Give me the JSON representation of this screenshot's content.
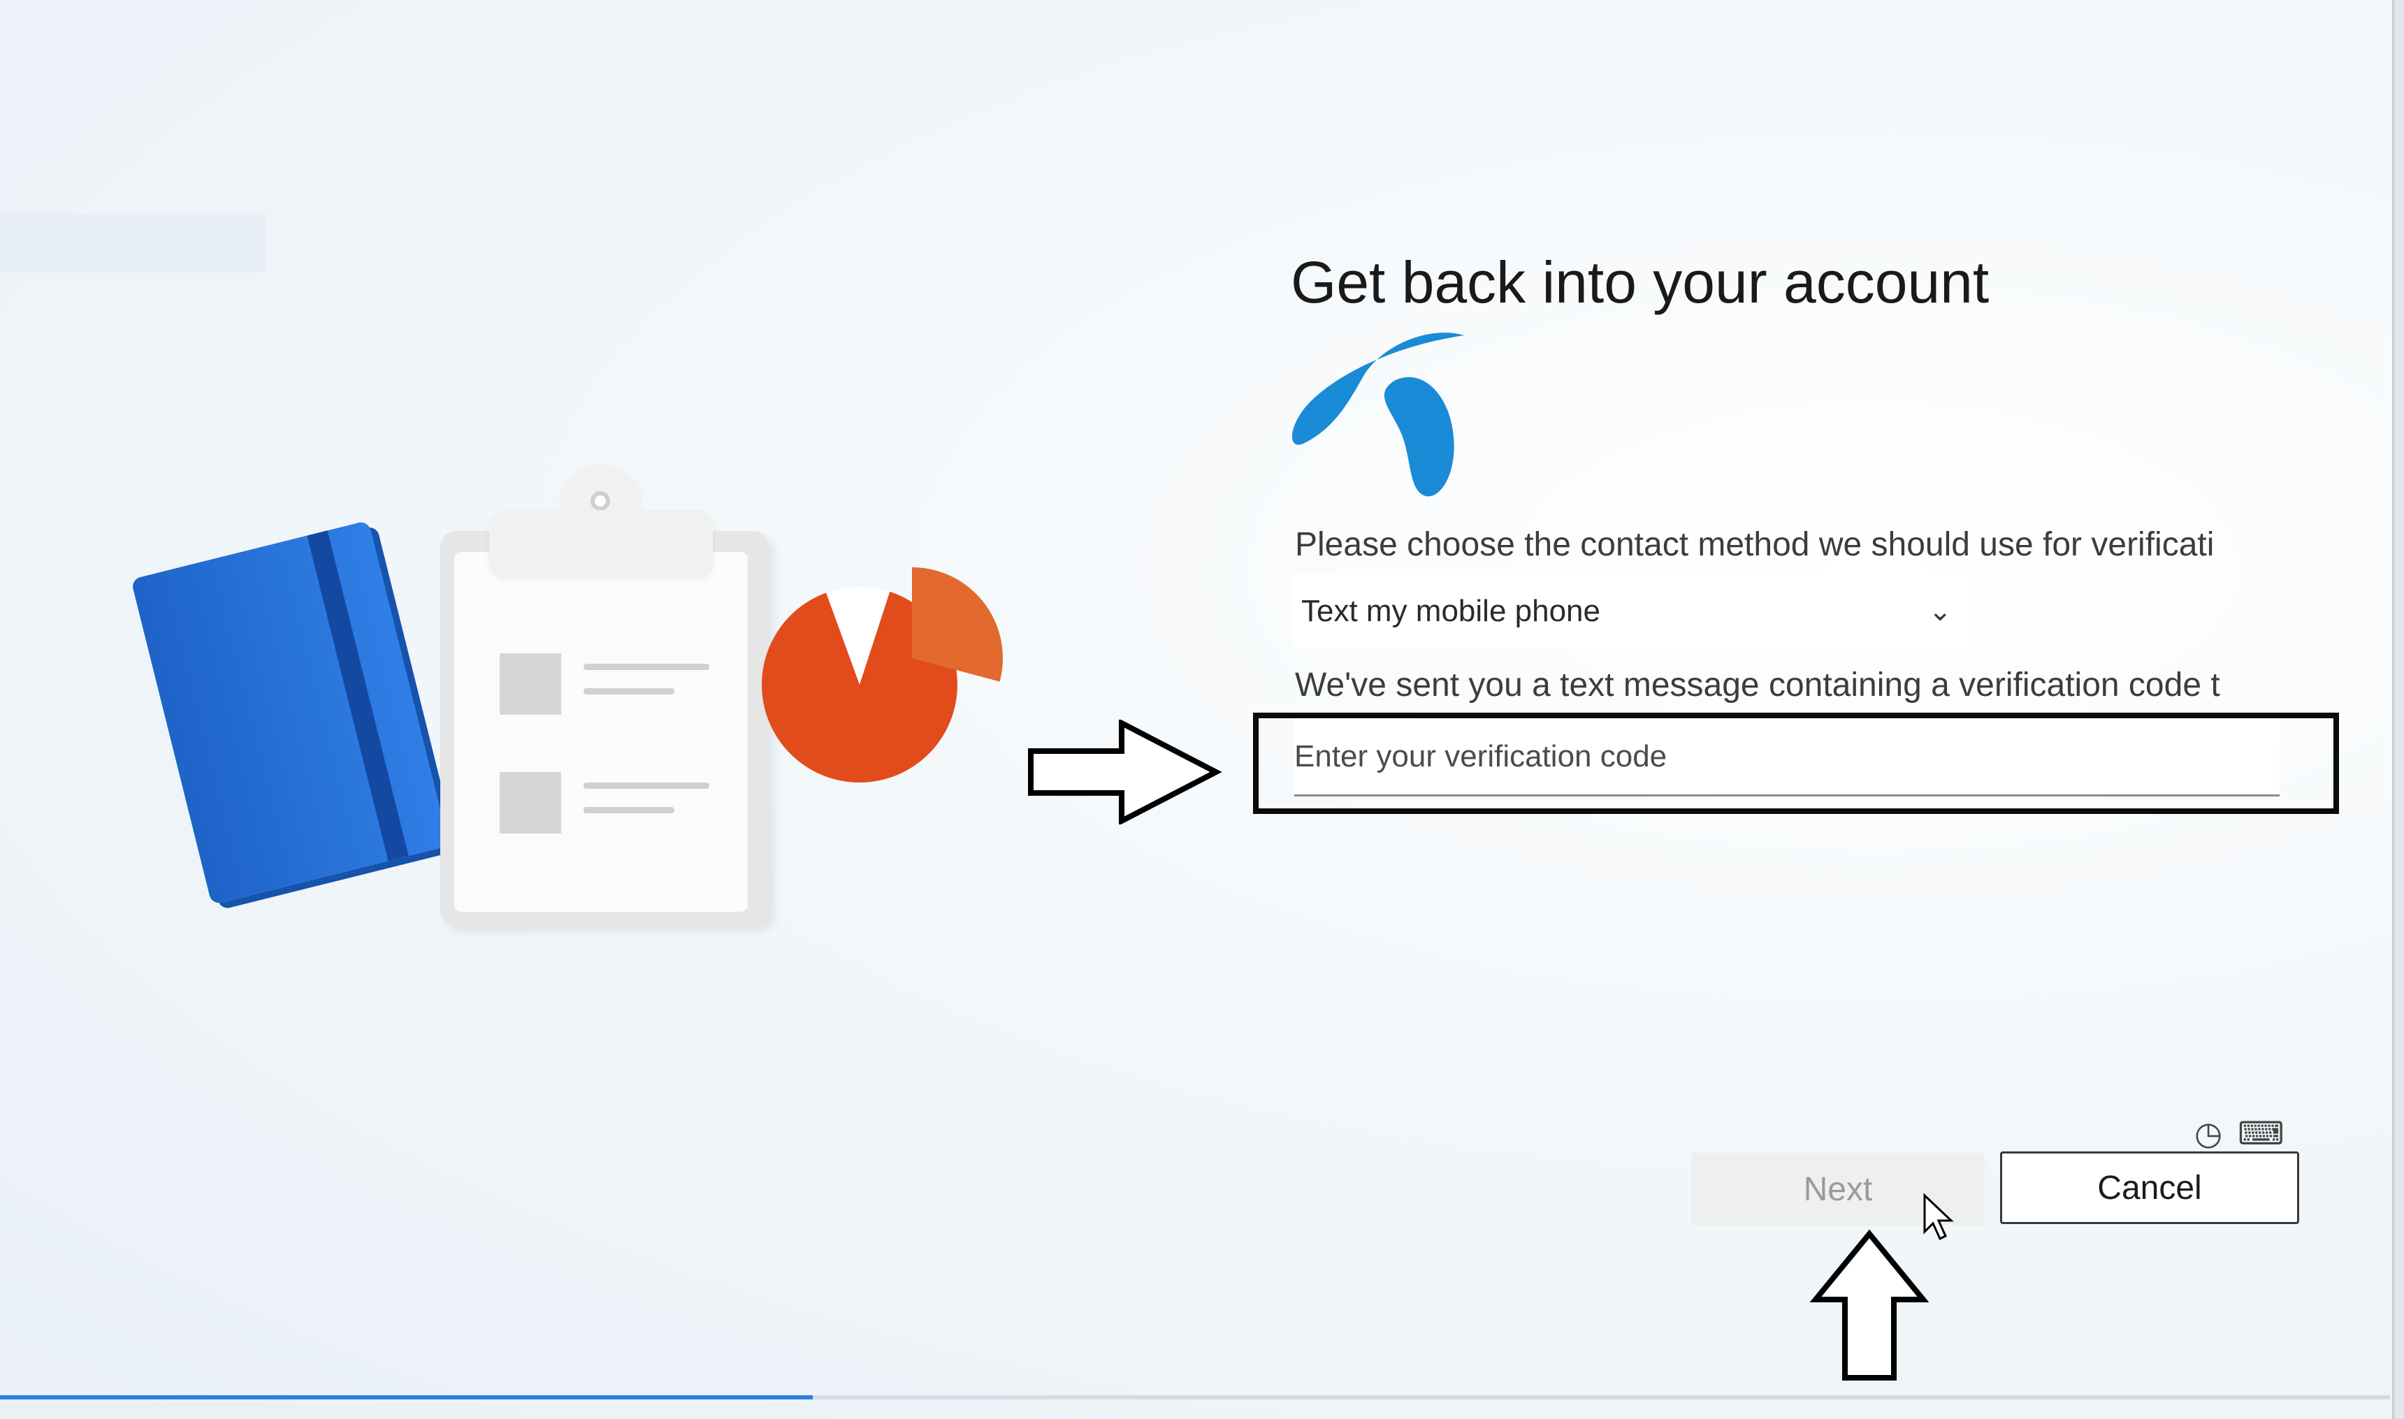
{
  "title": "Get back into your account",
  "contact_method_label": "Please choose the contact method we should use for verificati",
  "contact_method": {
    "selected": "Text my mobile phone"
  },
  "sent_message_label": "We've sent you a text message containing a verification code t",
  "verification_input": {
    "value": "",
    "placeholder": "Enter your verification code"
  },
  "buttons": {
    "next_label": "Next",
    "cancel_label": "Cancel"
  },
  "system_icons": [
    "accessibility-icon",
    "keyboard-icon"
  ],
  "progress": {
    "fraction": 0.34
  },
  "colors": {
    "logo": "#1a8bd6",
    "highlight_box": "#0b0b0b",
    "progress_fill": "#2f7fe0"
  }
}
